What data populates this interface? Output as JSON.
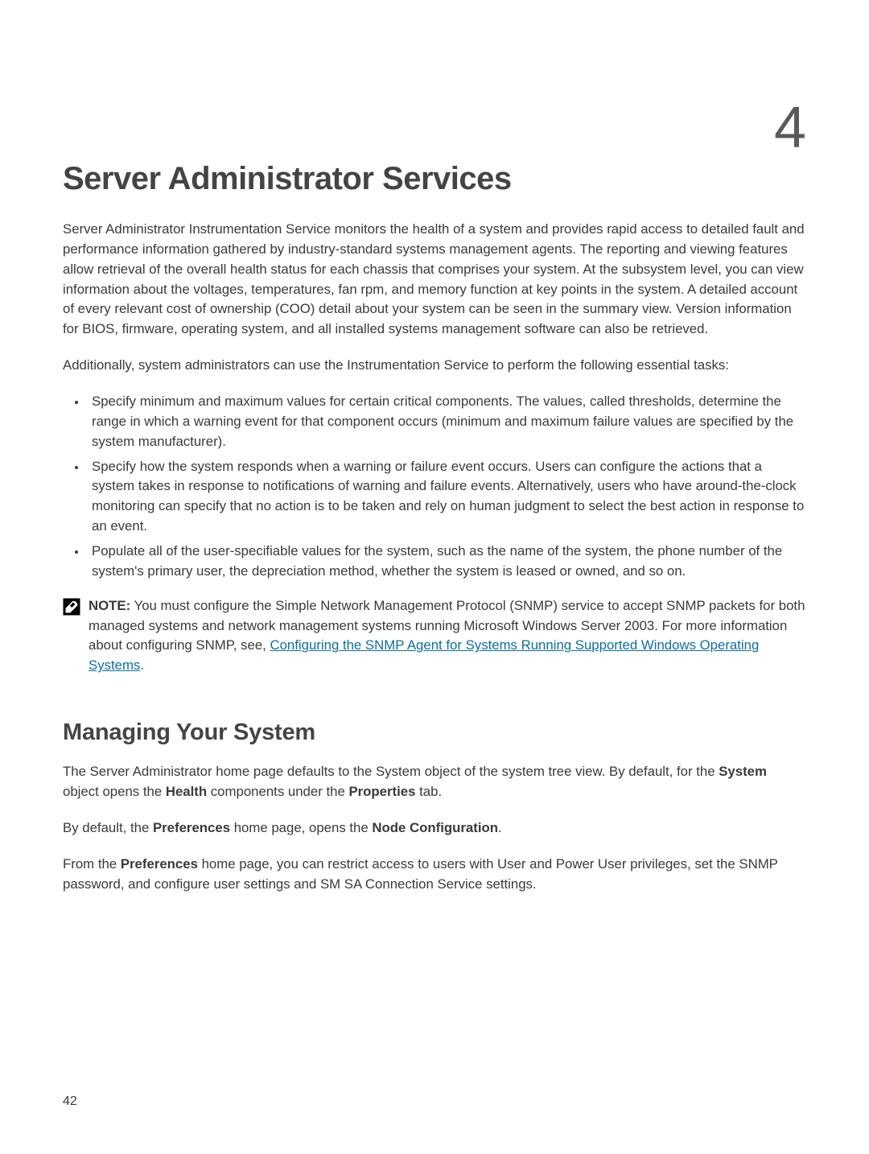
{
  "chapter_number": "4",
  "h1": "Server Administrator Services",
  "intro_para": "Server Administrator Instrumentation Service monitors the health of a system and provides rapid access to detailed fault and performance information gathered by industry-standard systems management agents. The reporting and viewing features allow retrieval of the overall health status for each chassis that comprises your system. At the subsystem level, you can view information about the voltages, temperatures, fan rpm, and memory function at key points in the system. A detailed account of every relevant cost of ownership (COO) detail about your system can be seen in the summary view. Version information for BIOS, firmware, operating system, and all installed systems management software can also be retrieved.",
  "tasks_intro": "Additionally, system administrators can use the Instrumentation Service to perform the following essential tasks:",
  "bullets": [
    "Specify minimum and maximum values for certain critical components. The values, called thresholds, determine the range in which a warning event for that component occurs (minimum and maximum failure values are specified by the system manufacturer).",
    "Specify how the system responds when a warning or failure event occurs. Users can configure the actions that a system takes in response to notifications of warning and failure events. Alternatively, users who have around-the-clock monitoring can specify that no action is to be taken and rely on human judgment to select the best action in response to an event.",
    "Populate all of the user-specifiable values for the system, such as the name of the system, the phone number of the system's primary user, the depreciation method, whether the system is leased or owned, and so on."
  ],
  "note": {
    "label": "NOTE:",
    "body_before_link": " You must configure the Simple Network Management Protocol (SNMP) service to accept SNMP packets for both managed systems and network management systems running Microsoft Windows Server 2003. For more information about configuring SNMP, see, ",
    "link_text": "Configuring the SNMP Agent for Systems Running Supported Windows Operating Systems",
    "body_after_link": "."
  },
  "h2": "Managing Your System",
  "mys_p1_pre": "The Server Administrator home page defaults to the System object of the system tree view. By default, for the ",
  "mys_p1_b1": "System",
  "mys_p1_mid1": " object opens the ",
  "mys_p1_b2": "Health",
  "mys_p1_mid2": " components under the ",
  "mys_p1_b3": "Properties",
  "mys_p1_post": " tab.",
  "mys_p2_pre": "By default, the ",
  "mys_p2_b1": "Preferences",
  "mys_p2_mid": " home page, opens the ",
  "mys_p2_b2": "Node Configuration",
  "mys_p2_post": ".",
  "mys_p3_pre": "From the ",
  "mys_p3_b1": "Preferences",
  "mys_p3_post": " home page, you can restrict access to users with User and Power User privileges, set the SNMP password, and configure user settings and SM SA Connection Service settings.",
  "page_number": "42"
}
